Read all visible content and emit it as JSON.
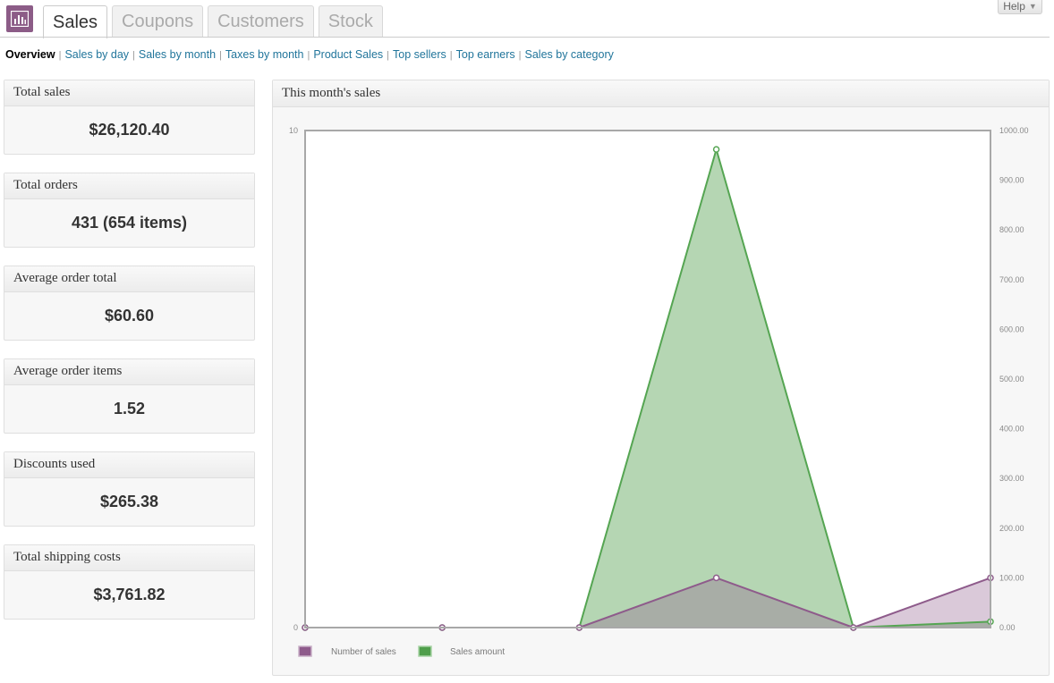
{
  "tabs": [
    {
      "label": "Sales"
    },
    {
      "label": "Coupons"
    },
    {
      "label": "Customers"
    },
    {
      "label": "Stock"
    }
  ],
  "help_label": "Help",
  "subnav": [
    {
      "label": "Overview"
    },
    {
      "label": "Sales by day"
    },
    {
      "label": "Sales by month"
    },
    {
      "label": "Taxes by month"
    },
    {
      "label": "Product Sales"
    },
    {
      "label": "Top sellers"
    },
    {
      "label": "Top earners"
    },
    {
      "label": "Sales by category"
    }
  ],
  "stats": [
    {
      "label": "Total sales",
      "value": "$26,120.40"
    },
    {
      "label": "Total orders",
      "value": "431 (654 items)"
    },
    {
      "label": "Average order total",
      "value": "$60.60"
    },
    {
      "label": "Average order items",
      "value": "1.52"
    },
    {
      "label": "Discounts used",
      "value": "$265.38"
    },
    {
      "label": "Total shipping costs",
      "value": "$3,761.82"
    }
  ],
  "panel_title": "This month's sales",
  "colors": {
    "brand": "#8c5c87",
    "link": "#21759b",
    "sales_count": "#8e5b8b",
    "sales_amount": "#4f9e4b"
  },
  "chart_data": {
    "type": "area",
    "title": "This month's sales",
    "x_index": [
      0,
      1,
      2,
      3,
      4,
      5
    ],
    "left_axis": {
      "ticks": [
        "0",
        "10"
      ],
      "ylim": [
        0,
        10
      ]
    },
    "right_axis": {
      "ticks": [
        "0.00",
        "100.00",
        "200.00",
        "300.00",
        "400.00",
        "500.00",
        "600.00",
        "700.00",
        "800.00",
        "900.00",
        "1000.00"
      ],
      "ylim": [
        0,
        1000
      ]
    },
    "series": [
      {
        "name": "Number of sales",
        "axis": "left",
        "values": [
          0,
          0,
          0,
          1,
          0,
          1
        ]
      },
      {
        "name": "Sales amount",
        "axis": "right",
        "values": [
          0,
          0,
          0,
          962,
          0,
          12
        ]
      }
    ],
    "legend": "bottom-left"
  }
}
